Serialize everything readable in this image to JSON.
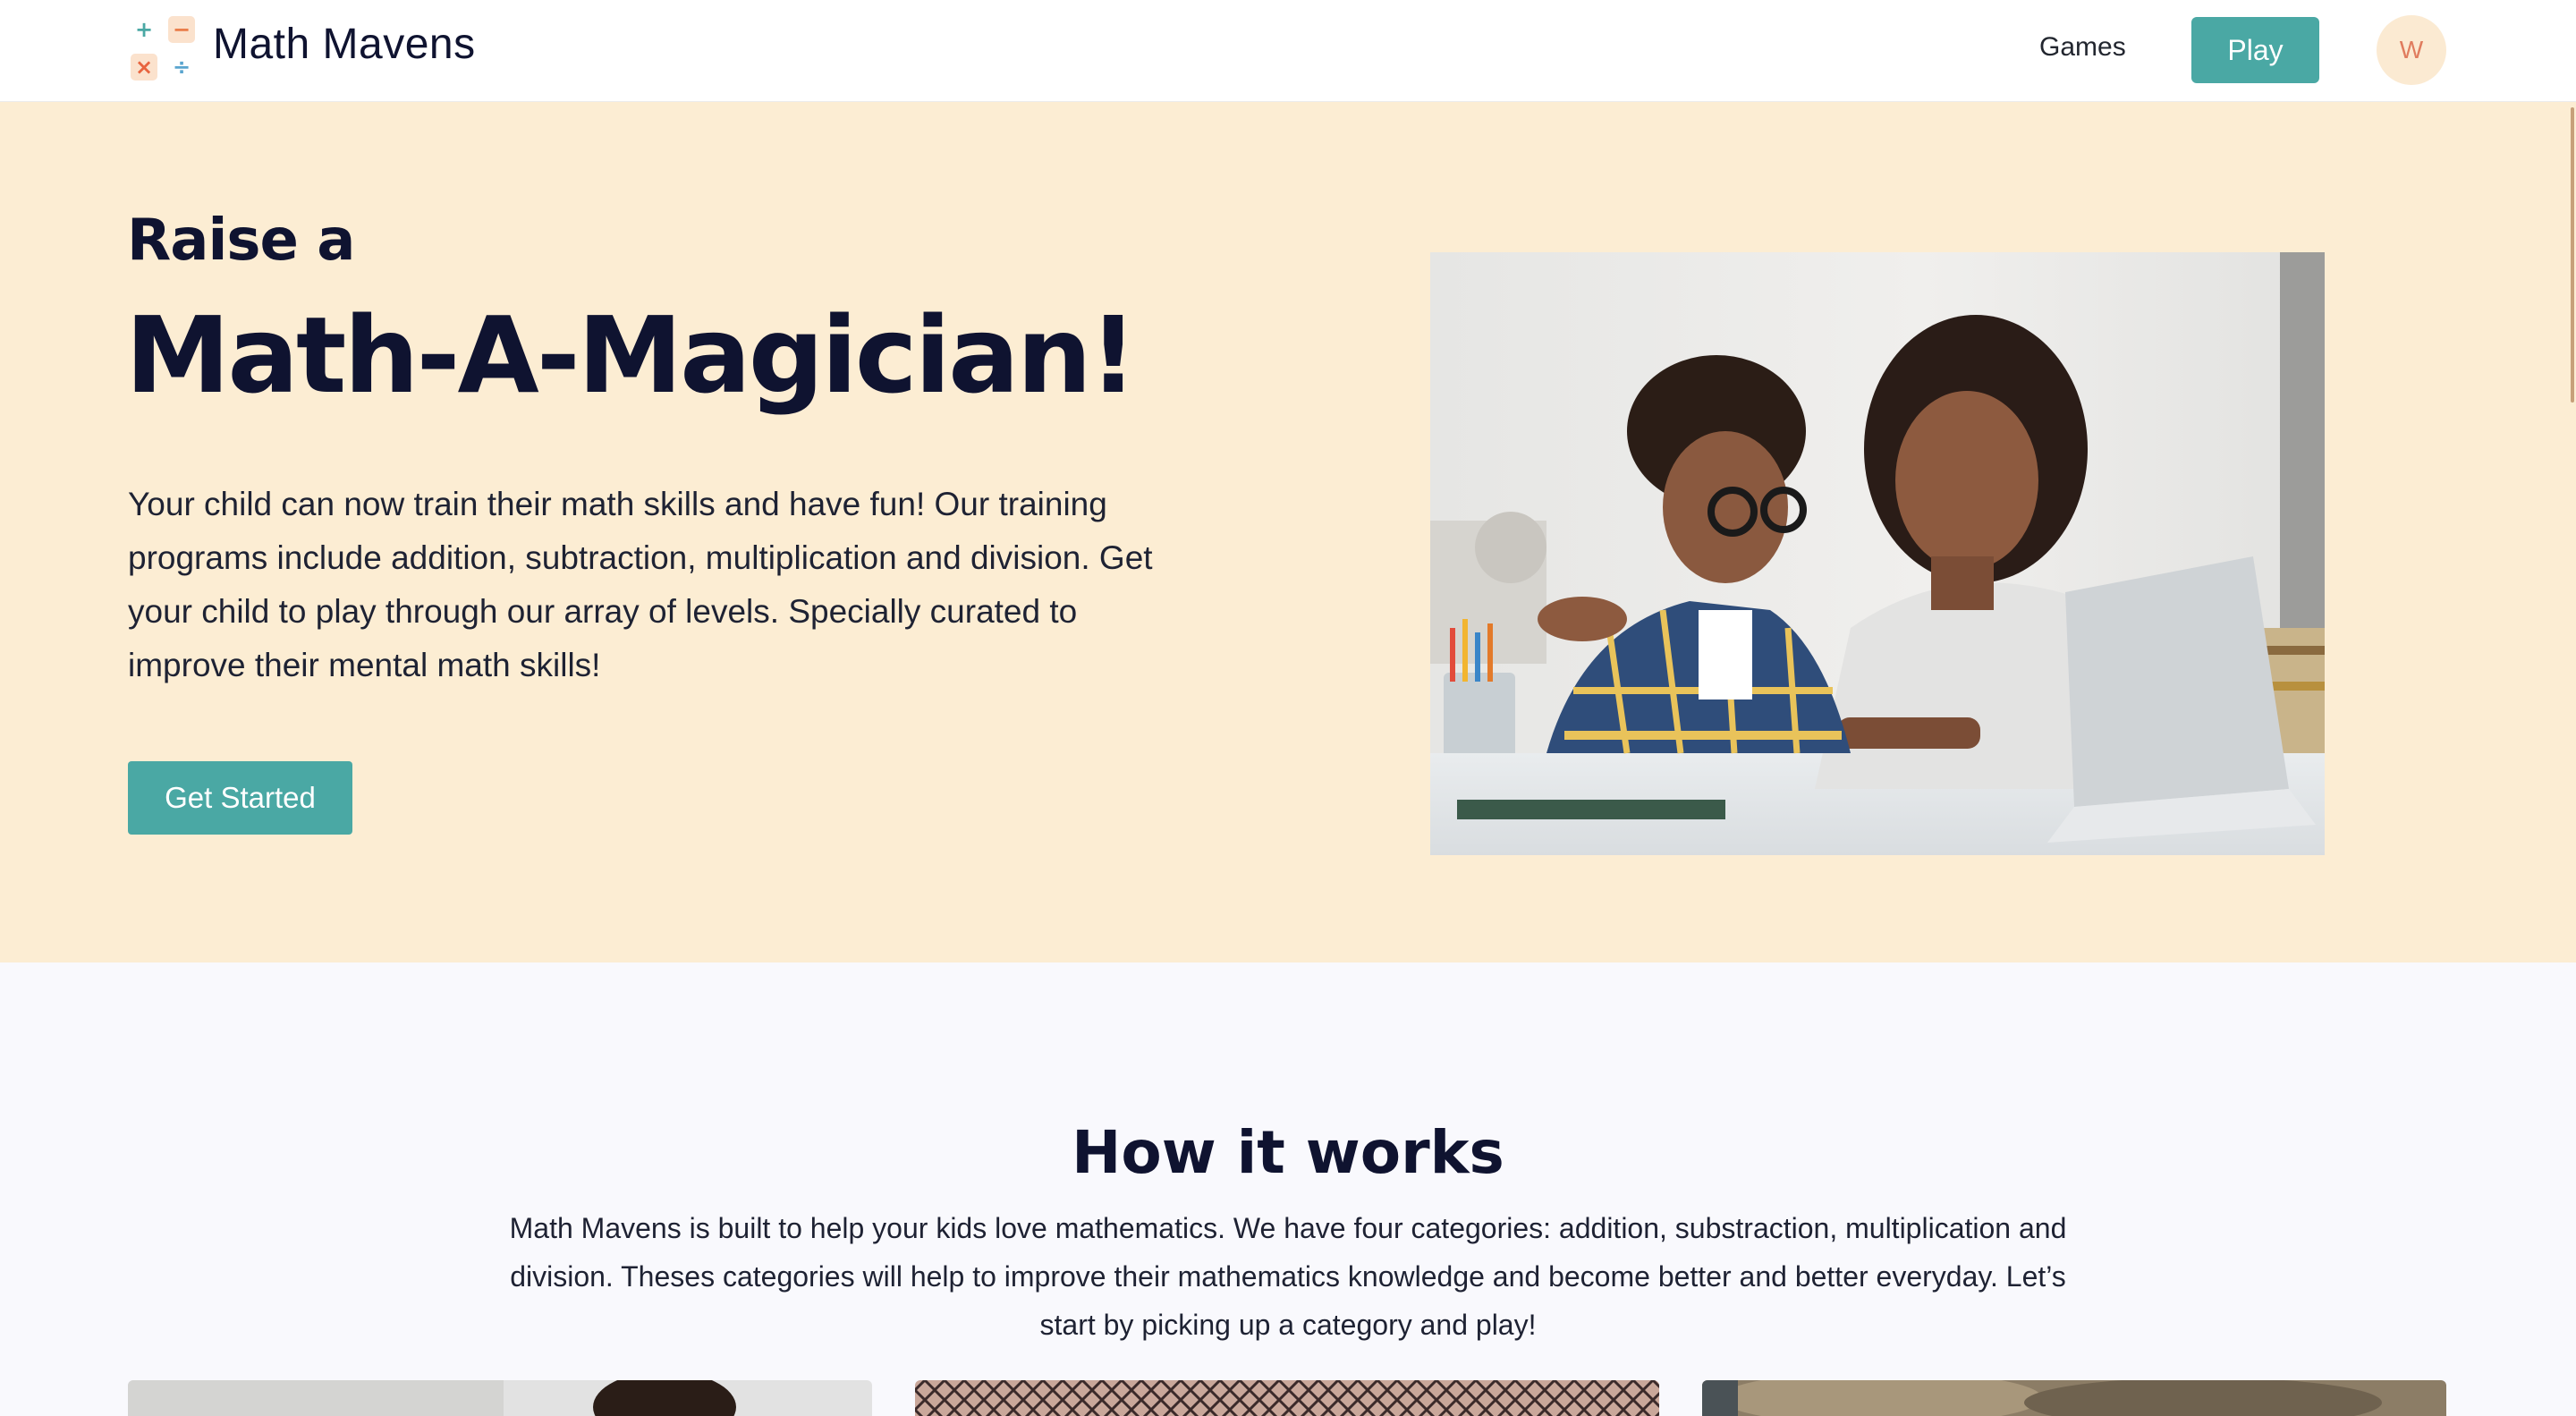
{
  "brand": {
    "name": "Math Mavens",
    "logo_symbols": [
      "+",
      "−",
      "×",
      "÷"
    ]
  },
  "nav": {
    "games_label": "Games",
    "play_label": "Play",
    "avatar_initial": "W"
  },
  "hero": {
    "eyebrow": "Raise a",
    "title": "Math-A-Magician!",
    "description": "Your child can now train their math skills and have fun! Our training programs include addition, subtraction, multiplication and division. Get your child to play through our array of levels. Specially curated to improve their mental math skills!",
    "cta_label": "Get Started"
  },
  "how_it_works": {
    "title": "How it works",
    "description": "Math Mavens is built to help your kids love mathematics. We have four categories: addition, substraction, multiplication and division. Theses categories will help to improve their mathematics knowledge and become better and better everyday. Let’s start by picking up a category and play!"
  },
  "colors": {
    "accent": "#4aa8a4",
    "hero_bg": "#fcedd3",
    "heading": "#0f1330",
    "avatar_bg": "#fbead2"
  }
}
